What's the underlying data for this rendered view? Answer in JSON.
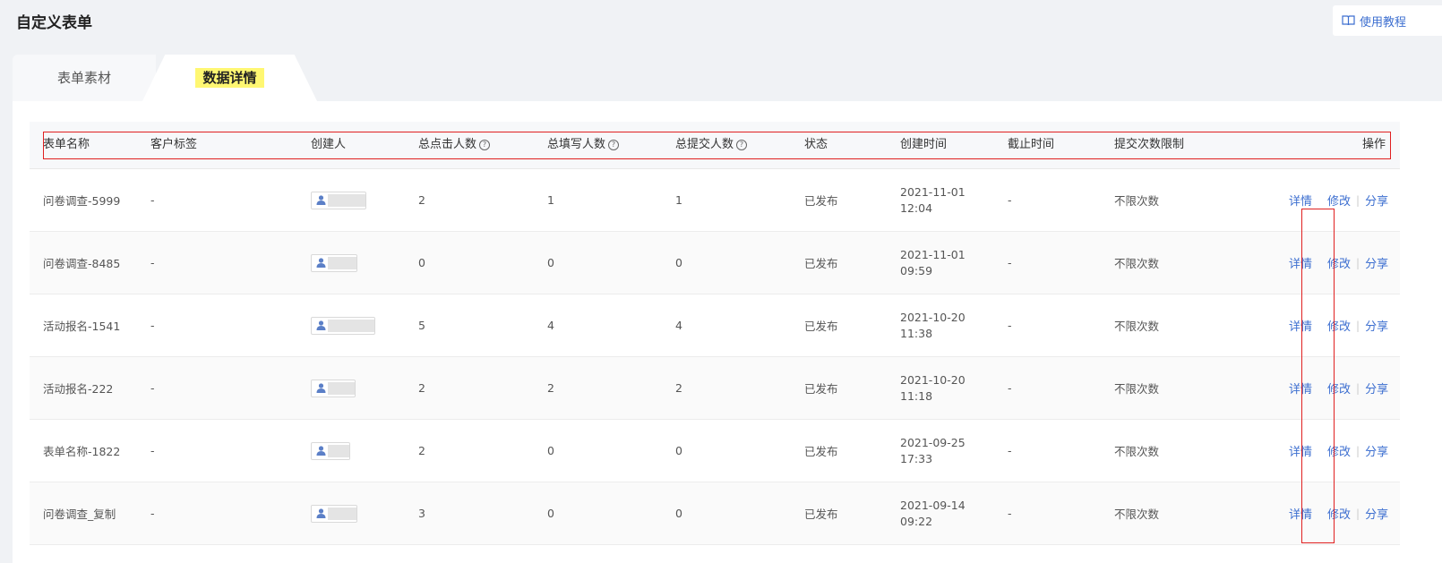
{
  "page": {
    "title": "自定义表单",
    "help_label": "使用教程"
  },
  "tabs": [
    {
      "label": "表单素材",
      "active": false
    },
    {
      "label": "数据详情",
      "active": true
    }
  ],
  "table": {
    "columns": [
      "表单名称",
      "客户标签",
      "创建人",
      "总点击人数",
      "总填写人数",
      "总提交人数",
      "状态",
      "创建时间",
      "截止时间",
      "提交次数限制",
      "操作"
    ],
    "help_mark": "?",
    "rows": [
      {
        "name": "问卷调查-5999",
        "tag": "-",
        "clicks": "2",
        "fills": "1",
        "submits": "1",
        "status": "已发布",
        "date": "2021-11-01",
        "time": "12:04",
        "deadline": "-",
        "limit": "不限次数"
      },
      {
        "name": "问卷调查-8485",
        "tag": "-",
        "clicks": "0",
        "fills": "0",
        "submits": "0",
        "status": "已发布",
        "date": "2021-11-01",
        "time": "09:59",
        "deadline": "-",
        "limit": "不限次数"
      },
      {
        "name": "活动报名-1541",
        "tag": "-",
        "clicks": "5",
        "fills": "4",
        "submits": "4",
        "status": "已发布",
        "date": "2021-10-20",
        "time": "11:38",
        "deadline": "-",
        "limit": "不限次数"
      },
      {
        "name": "活动报名-222",
        "tag": "-",
        "clicks": "2",
        "fills": "2",
        "submits": "2",
        "status": "已发布",
        "date": "2021-10-20",
        "time": "11:18",
        "deadline": "-",
        "limit": "不限次数"
      },
      {
        "name": "表单名称-1822",
        "tag": "-",
        "clicks": "2",
        "fills": "0",
        "submits": "0",
        "status": "已发布",
        "date": "2021-09-25",
        "time": "17:33",
        "deadline": "-",
        "limit": "不限次数"
      },
      {
        "name": "问卷调查_复制",
        "tag": "-",
        "clicks": "3",
        "fills": "0",
        "submits": "0",
        "status": "已发布",
        "date": "2021-09-14",
        "time": "09:22",
        "deadline": "-",
        "limit": "不限次数"
      }
    ],
    "actions": {
      "detail": "详情",
      "edit": "修改",
      "share": "分享",
      "separator": "|"
    }
  },
  "colors": {
    "link": "#3d6fd0",
    "highlight": "#fff772",
    "annotation_box": "#e02020"
  },
  "icons": {
    "help": "book-icon",
    "creator": "user-icon",
    "column_help": "question-circle-icon"
  }
}
